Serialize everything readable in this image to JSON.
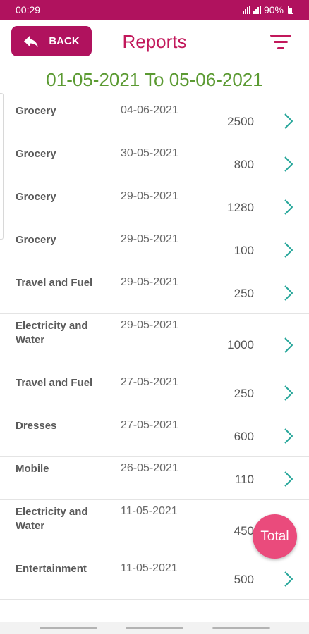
{
  "status_bar": {
    "time": "00:29",
    "battery": "90%",
    "background": "#b0125e"
  },
  "header": {
    "back_label": "BACK",
    "back_icon": "reply-arrow-icon",
    "title": "Reports",
    "filter_icon": "filter-icon",
    "accent": "#c2185b"
  },
  "date_range": {
    "text": "01-05-2021 To 05-06-2021",
    "color": "#5b9a32"
  },
  "reports": [
    {
      "category": "Grocery",
      "date": "04-06-2021",
      "amount": "2500"
    },
    {
      "category": "Grocery",
      "date": "30-05-2021",
      "amount": "800"
    },
    {
      "category": "Grocery",
      "date": "29-05-2021",
      "amount": "1280"
    },
    {
      "category": "Grocery",
      "date": "29-05-2021",
      "amount": "100"
    },
    {
      "category": "Travel and Fuel",
      "date": "29-05-2021",
      "amount": "250"
    },
    {
      "category": "Electricity and Water",
      "date": "29-05-2021",
      "amount": "1000"
    },
    {
      "category": "Travel and Fuel",
      "date": "27-05-2021",
      "amount": "250"
    },
    {
      "category": "Dresses",
      "date": "27-05-2021",
      "amount": "600"
    },
    {
      "category": "Mobile",
      "date": "26-05-2021",
      "amount": "110"
    },
    {
      "category": "Electricity and Water",
      "date": "11-05-2021",
      "amount": "450"
    },
    {
      "category": "Entertainment",
      "date": "11-05-2021",
      "amount": "500"
    }
  ],
  "total_button": {
    "label": "Total",
    "color": "#ea4b7c"
  },
  "chevron_color": "#26a69a"
}
